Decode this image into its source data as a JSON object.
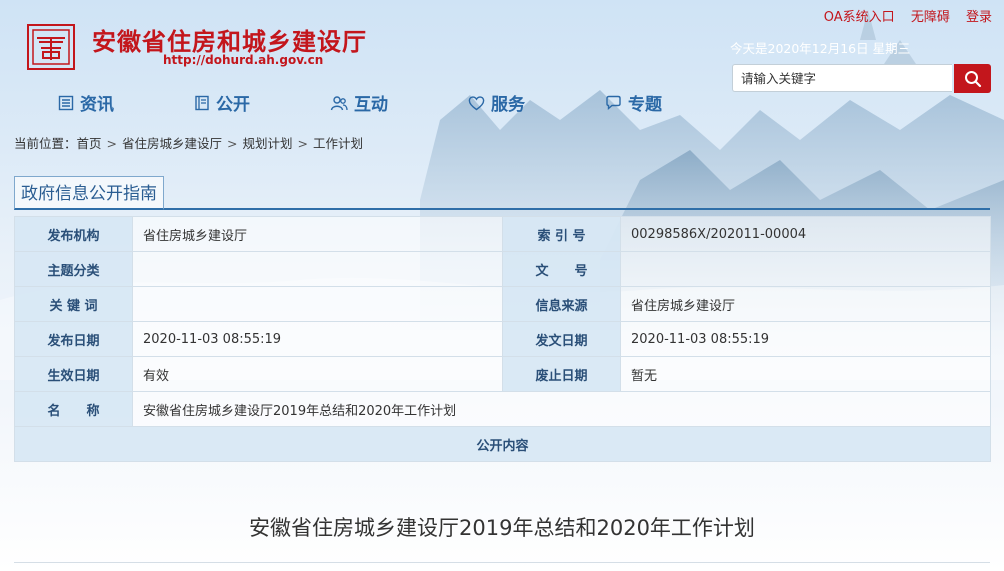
{
  "header": {
    "site_title": "安徽省住房和城乡建设厅",
    "site_url": "http://dohurd.ah.gov.cn",
    "logo_icon": "government-emblem-icon",
    "top_links": [
      "OA系统入口",
      "无障碍",
      "登录"
    ],
    "date_text": "今天是2020年12月16日 星期三",
    "search": {
      "placeholder": "请输入关键字",
      "icon": "search-icon"
    }
  },
  "nav": [
    {
      "label": "资讯",
      "icon": "list-icon"
    },
    {
      "label": "公开",
      "icon": "book-icon"
    },
    {
      "label": "互动",
      "icon": "people-icon"
    },
    {
      "label": "服务",
      "icon": "heart-icon"
    },
    {
      "label": "专题",
      "icon": "chat-bubble-icon"
    }
  ],
  "breadcrumb": {
    "prefix": "当前位置：",
    "items": [
      "首页",
      "省住房城乡建设厅",
      "规划计划",
      "工作计划"
    ],
    "separator": ">"
  },
  "panel": {
    "title": "政府信息公开指南",
    "rows": [
      {
        "l1": "发布机构",
        "v1": "省住房城乡建设厅",
        "l2": "索 引 号",
        "v2": "00298586X/202011-00004"
      },
      {
        "l1": "主题分类",
        "v1": "",
        "l2": "文　　号",
        "v2": ""
      },
      {
        "l1": "关 键 词",
        "v1": "",
        "l2": "信息来源",
        "v2": "省住房城乡建设厅"
      },
      {
        "l1": "发布日期",
        "v1": "2020-11-03 08:55:19",
        "l2": "发文日期",
        "v2": "2020-11-03 08:55:19"
      },
      {
        "l1": "生效日期",
        "v1": "有效",
        "l2": "废止日期",
        "v2": "暂无"
      }
    ],
    "name_label": "名　　称",
    "name_value": "安徽省住房城乡建设厅2019年总结和2020年工作计划",
    "open_content_label": "公开内容"
  },
  "article": {
    "title": "安徽省住房城乡建设厅2019年总结和2020年工作计划"
  },
  "colors": {
    "brand_red": "#c3161c",
    "nav_blue": "#2a68a6",
    "label_bg": "#d7e7f4"
  }
}
